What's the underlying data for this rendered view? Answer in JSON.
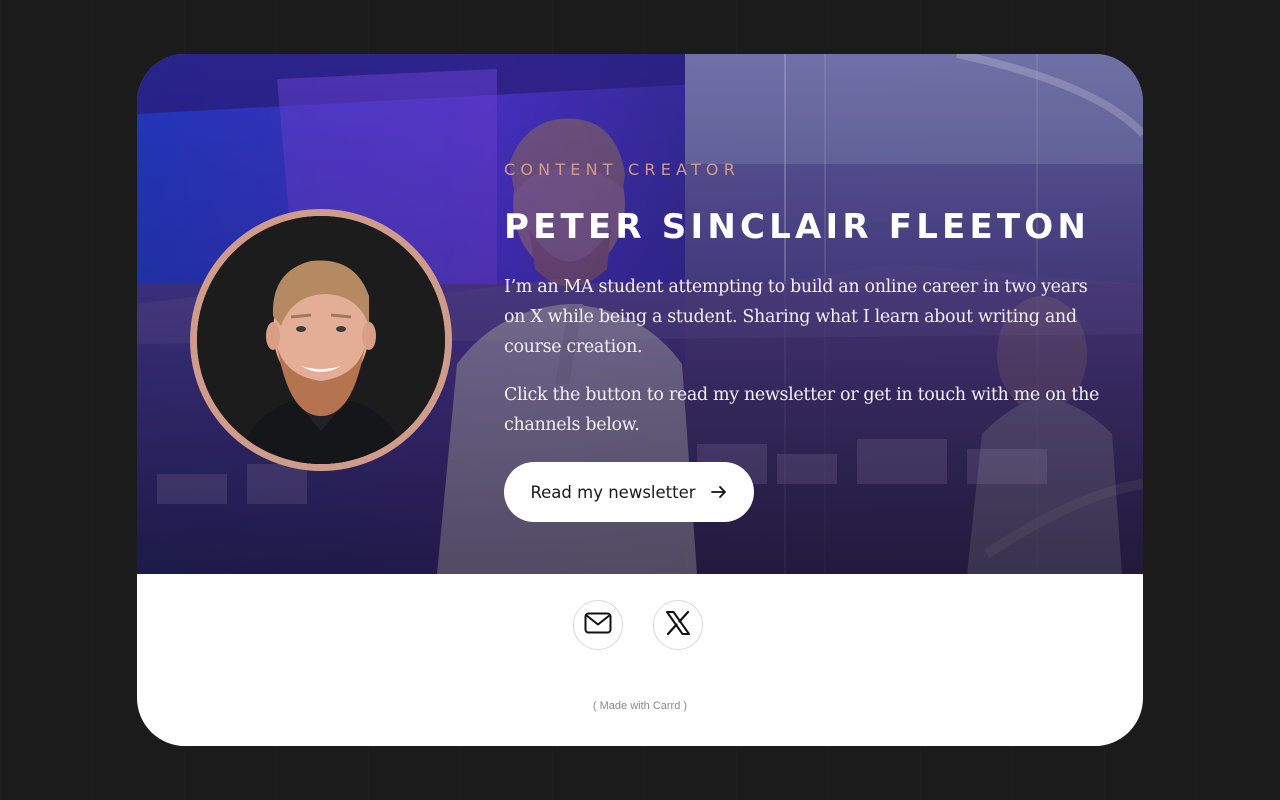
{
  "profile": {
    "role": "CONTENT CREATOR",
    "name": "PETER SINCLAIR FLEETON",
    "bio_1": "I’m an MA student attempting to build an online career in two years on X while being a student. Sharing what I learn about writing and course creation.",
    "bio_2": "Click the button to read my newsletter or get in touch with me on the channels below.",
    "avatar_icon": "portrait-photo"
  },
  "cta": {
    "label": "Read my newsletter",
    "icon": "arrow-right-icon"
  },
  "social": [
    {
      "name": "email",
      "icon": "envelope-icon"
    },
    {
      "name": "x",
      "icon": "x-logo-icon"
    }
  ],
  "footer": {
    "credit_open": "( ",
    "credit_link": "Made with Carrd",
    "credit_close": " )"
  },
  "colors": {
    "page_background": "#1b1b1b",
    "card_background": "#ffffff",
    "accent": "#cf9b8a",
    "hero_overlay": "#3a2f8a"
  }
}
